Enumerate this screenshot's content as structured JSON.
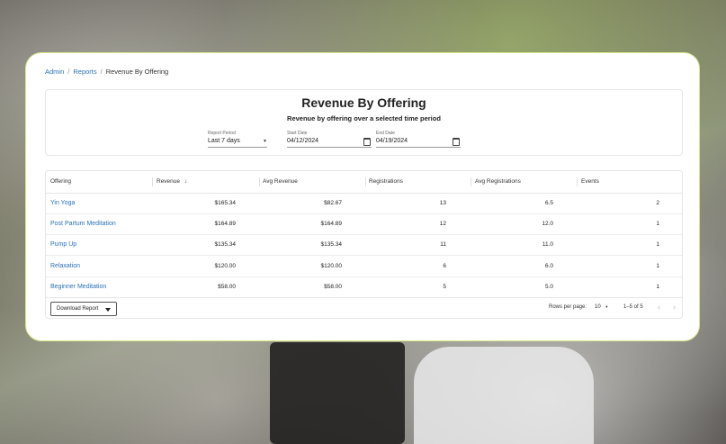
{
  "breadcrumb": {
    "items": [
      "Admin",
      "Reports",
      "Revenue By Offering"
    ],
    "separator": "/"
  },
  "report": {
    "title": "Revenue By Offering",
    "subtitle": "Revenue by offering over a selected time period",
    "filters": {
      "period": {
        "label": "Report Period",
        "value": "Last 7 days"
      },
      "start": {
        "label": "Start Date",
        "value": "04/12/2024"
      },
      "end": {
        "label": "End Date",
        "value": "04/19/2024"
      }
    }
  },
  "table": {
    "columns": [
      "Offering",
      "Revenue",
      "Avg Revenue",
      "Registrations",
      "Avg Registrations",
      "Events"
    ],
    "sort_indicator": "↓",
    "rows": [
      {
        "offering": "Yin Yoga",
        "revenue": "$165.34",
        "avg_revenue": "$82.67",
        "registrations": "13",
        "avg_registrations": "6.5",
        "events": "2"
      },
      {
        "offering": "Post Partum Meditation",
        "revenue": "$164.89",
        "avg_revenue": "$164.89",
        "registrations": "12",
        "avg_registrations": "12.0",
        "events": "1"
      },
      {
        "offering": "Pump Up",
        "revenue": "$135.34",
        "avg_revenue": "$135.34",
        "registrations": "11",
        "avg_registrations": "11.0",
        "events": "1"
      },
      {
        "offering": "Relaxation",
        "revenue": "$120.00",
        "avg_revenue": "$120.00",
        "registrations": "6",
        "avg_registrations": "6.0",
        "events": "1"
      },
      {
        "offering": "Beginner Meditation",
        "revenue": "$58.00",
        "avg_revenue": "$58.00",
        "registrations": "5",
        "avg_registrations": "5.0",
        "events": "1"
      }
    ]
  },
  "footer": {
    "download_label": "Download Report",
    "rows_per_page_label": "Rows per page:",
    "rows_per_page_value": "10",
    "range_text": "1–5 of 5",
    "prev_icon": "chevron-left-icon",
    "next_icon": "chevron-right-icon"
  },
  "colors": {
    "link": "#2a72b5",
    "card_border": "#d8e88a"
  }
}
